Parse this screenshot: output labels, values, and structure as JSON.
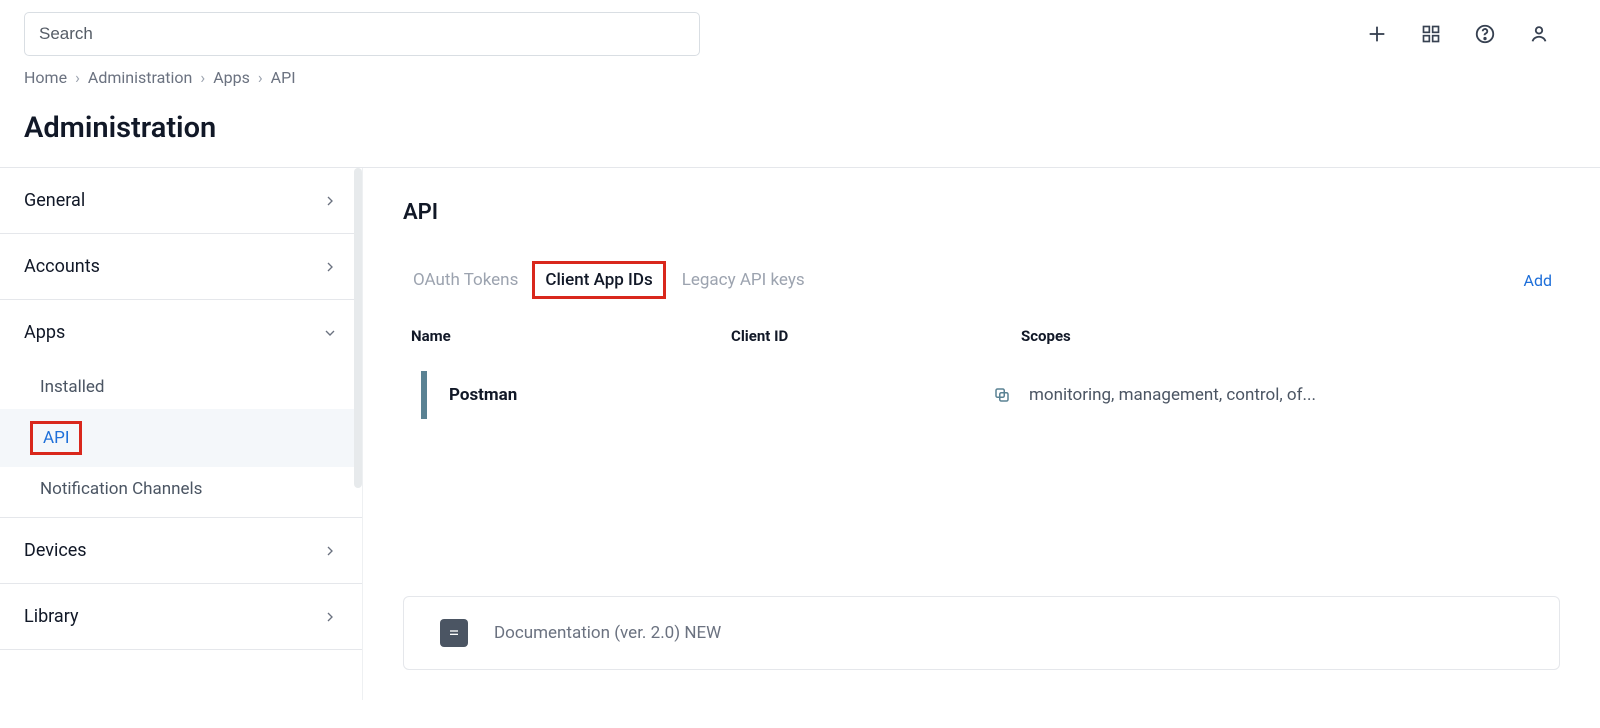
{
  "search": {
    "placeholder": "Search"
  },
  "breadcrumb": {
    "items": [
      "Home",
      "Administration",
      "Apps",
      "API"
    ]
  },
  "page_title": "Administration",
  "sidebar": {
    "items": [
      {
        "label": "General",
        "expanded": false
      },
      {
        "label": "Accounts",
        "expanded": false
      },
      {
        "label": "Apps",
        "expanded": true,
        "children": [
          {
            "label": "Installed",
            "active": false
          },
          {
            "label": "API",
            "active": true
          },
          {
            "label": "Notification Channels",
            "active": false
          }
        ]
      },
      {
        "label": "Devices",
        "expanded": false
      },
      {
        "label": "Library",
        "expanded": false
      }
    ]
  },
  "main": {
    "title": "API",
    "tabs": {
      "oauth": "OAuth Tokens",
      "client": "Client App IDs",
      "legacy": "Legacy API keys"
    },
    "add_label": "Add",
    "columns": {
      "name": "Name",
      "client_id": "Client ID",
      "scopes": "Scopes"
    },
    "rows": [
      {
        "name": "Postman",
        "client_id": "",
        "scopes": "monitoring, management, control, of..."
      }
    ],
    "doc_label": "Documentation (ver. 2.0) NEW"
  },
  "top_icons": {
    "plus": "plus-icon",
    "grid": "grid-icon",
    "help": "help-icon",
    "user": "user-icon"
  }
}
